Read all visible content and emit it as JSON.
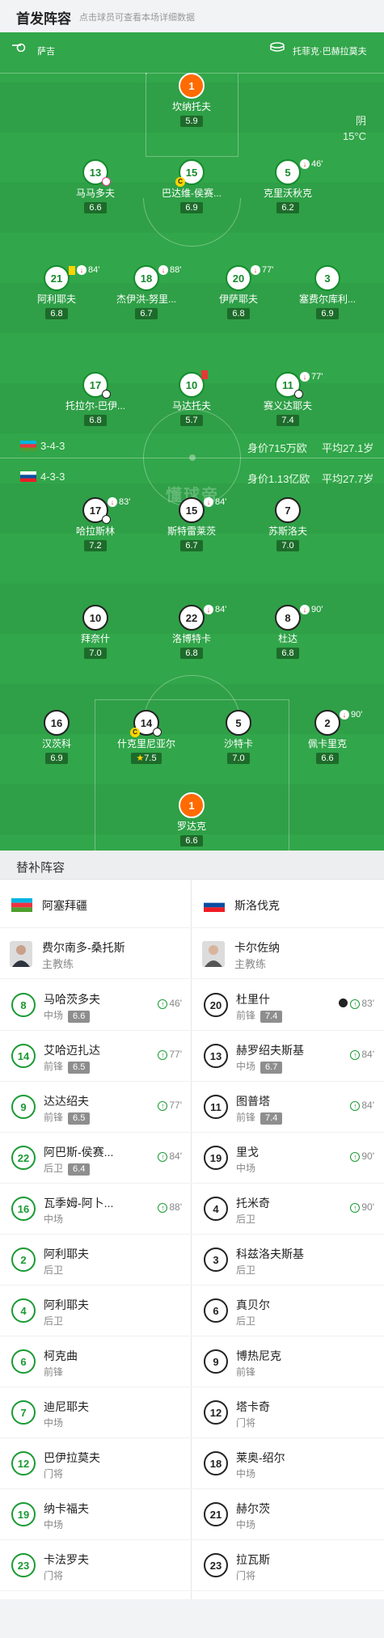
{
  "header": {
    "title": "首发阵容",
    "subtitle": "点击球员可查看本场详细数据"
  },
  "field": {
    "referee": "萨吉",
    "venue": "托菲克·巴赫拉莫夫",
    "weather": "阴",
    "temperature": "15°C",
    "watermark": "懂球帝"
  },
  "home_info": {
    "formation": "3-4-3",
    "value": "身价715万欧",
    "age": "平均27.1岁"
  },
  "away_info": {
    "formation": "4-3-3",
    "value": "身价1.13亿欧",
    "age": "平均27.7岁"
  },
  "home_lineup": [
    {
      "num": "1",
      "name": "坎纳托夫",
      "rating": "5.9"
    },
    {
      "num": "13",
      "name": "马马多夫",
      "rating": "6.6"
    },
    {
      "num": "15",
      "name": "巴达维-侯赛...",
      "rating": "6.9",
      "extra": ""
    },
    {
      "num": "5",
      "name": "克里沃秋克",
      "rating": "6.2",
      "extra": "46'"
    },
    {
      "num": "21",
      "name": "阿利耶夫",
      "rating": "6.8",
      "extra": "84'"
    },
    {
      "num": "18",
      "name": "杰伊洪-努里...",
      "rating": "6.7",
      "extra": "88'"
    },
    {
      "num": "20",
      "name": "伊萨耶夫",
      "rating": "6.8",
      "extra": "77'"
    },
    {
      "num": "3",
      "name": "塞费尔库利...",
      "rating": "6.9"
    },
    {
      "num": "17",
      "name": "托拉尔-巴伊...",
      "rating": "6.8"
    },
    {
      "num": "10",
      "name": "马达托夫",
      "rating": "5.7"
    },
    {
      "num": "11",
      "name": "赛义达耶夫",
      "rating": "7.4",
      "extra": "77'"
    }
  ],
  "away_lineup": [
    {
      "num": "17",
      "name": "哈拉斯林",
      "rating": "7.2",
      "extra": "83'"
    },
    {
      "num": "15",
      "name": "斯特雷莱茨",
      "rating": "6.7",
      "extra": "84'"
    },
    {
      "num": "7",
      "name": "苏斯洛夫",
      "rating": "7.0"
    },
    {
      "num": "10",
      "name": "拜奈什",
      "rating": "7.0"
    },
    {
      "num": "22",
      "name": "洛博特卡",
      "rating": "6.8",
      "extra": "84'"
    },
    {
      "num": "8",
      "name": "杜达",
      "rating": "6.8",
      "extra": "90'"
    },
    {
      "num": "16",
      "name": "汉茨科",
      "rating": "6.9"
    },
    {
      "num": "14",
      "name": "什克里尼亚尔",
      "rating": "7.5"
    },
    {
      "num": "5",
      "name": "沙特卡",
      "rating": "7.0"
    },
    {
      "num": "2",
      "name": "佩卡里克",
      "rating": "6.6",
      "extra": "90'"
    },
    {
      "num": "1",
      "name": "罗达克",
      "rating": "6.6"
    }
  ],
  "subs": {
    "title": "替补阵容",
    "home": {
      "team": "阿塞拜疆",
      "coach": "费尔南多-桑托斯",
      "coach_role": "主教练",
      "players": [
        {
          "num": "8",
          "name": "马哈茨多夫",
          "pos": "中场",
          "rating": "6.6",
          "time": "46'"
        },
        {
          "num": "14",
          "name": "艾哈迈扎达",
          "pos": "前锋",
          "rating": "6.5",
          "time": "77'"
        },
        {
          "num": "9",
          "name": "达达绍夫",
          "pos": "前锋",
          "rating": "6.5",
          "time": "77'"
        },
        {
          "num": "22",
          "name": "阿巴斯-侯赛...",
          "pos": "后卫",
          "rating": "6.4",
          "time": "84'"
        },
        {
          "num": "16",
          "name": "瓦季姆-阿卜...",
          "pos": "中场",
          "rating": "",
          "time": "88'"
        },
        {
          "num": "2",
          "name": "阿利耶夫",
          "pos": "后卫",
          "rating": "",
          "time": ""
        },
        {
          "num": "4",
          "name": "阿利耶夫",
          "pos": "后卫",
          "rating": "",
          "time": ""
        },
        {
          "num": "6",
          "name": "柯克曲",
          "pos": "前锋",
          "rating": "",
          "time": ""
        },
        {
          "num": "7",
          "name": "迪尼耶夫",
          "pos": "中场",
          "rating": "",
          "time": ""
        },
        {
          "num": "12",
          "name": "巴伊拉莫夫",
          "pos": "门将",
          "rating": "",
          "time": ""
        },
        {
          "num": "19",
          "name": "纳卡福夫",
          "pos": "中场",
          "rating": "",
          "time": ""
        },
        {
          "num": "23",
          "name": "卡法罗夫",
          "pos": "门将",
          "rating": "",
          "time": ""
        }
      ]
    },
    "away": {
      "team": "斯洛伐克",
      "coach": "卡尔佐纳",
      "coach_role": "主教练",
      "players": [
        {
          "num": "20",
          "name": "杜里什",
          "pos": "前锋",
          "rating": "7.4",
          "time": "83'"
        },
        {
          "num": "13",
          "name": "赫罗绍夫斯基",
          "pos": "中场",
          "rating": "6.7",
          "time": "84'"
        },
        {
          "num": "11",
          "name": "图普塔",
          "pos": "前锋",
          "rating": "7.4",
          "time": "84'"
        },
        {
          "num": "19",
          "name": "里戈",
          "pos": "中场",
          "rating": "",
          "time": "90'"
        },
        {
          "num": "4",
          "name": "托米奇",
          "pos": "后卫",
          "rating": "",
          "time": "90'"
        },
        {
          "num": "3",
          "name": "科兹洛夫斯基",
          "pos": "后卫",
          "rating": "",
          "time": ""
        },
        {
          "num": "6",
          "name": "真贝尔",
          "pos": "后卫",
          "rating": "",
          "time": ""
        },
        {
          "num": "9",
          "name": "博热尼克",
          "pos": "前锋",
          "rating": "",
          "time": ""
        },
        {
          "num": "12",
          "name": "塔卡奇",
          "pos": "门将",
          "rating": "",
          "time": ""
        },
        {
          "num": "18",
          "name": "莱奥-绍尔",
          "pos": "中场",
          "rating": "",
          "time": ""
        },
        {
          "num": "21",
          "name": "赫尔茨",
          "pos": "中场",
          "rating": "",
          "time": ""
        },
        {
          "num": "23",
          "name": "拉瓦斯",
          "pos": "门将",
          "rating": "",
          "time": ""
        }
      ]
    }
  }
}
